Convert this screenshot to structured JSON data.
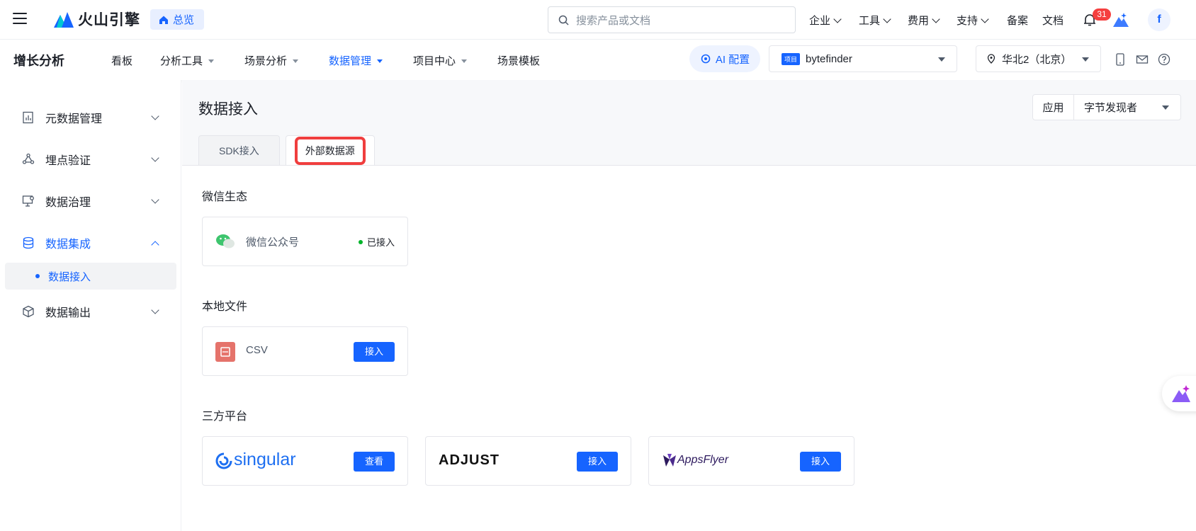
{
  "topbar": {
    "brand": "火山引擎",
    "overview_label": "总览",
    "search_placeholder": "搜索产品或文档",
    "nav": [
      "企业",
      "工具",
      "费用",
      "支持",
      "备案",
      "文档"
    ],
    "notification_count": "31",
    "avatar_initial": "f"
  },
  "subbar": {
    "product": "增长分析",
    "nav": [
      "看板",
      "分析工具",
      "场景分析",
      "数据管理",
      "项目中心",
      "场景模板"
    ],
    "ai_config": "AI 配置",
    "project_tag": "项目",
    "project_name": "bytefinder",
    "region": "华北2（北京）"
  },
  "sidebar": {
    "items": [
      "元数据管理",
      "埋点验证",
      "数据治理",
      "数据集成",
      "数据输出"
    ],
    "sub_item": "数据接入"
  },
  "main": {
    "title": "数据接入",
    "app_label": "应用",
    "app_value": "字节发现者",
    "tabs": [
      "SDK接入",
      "外部数据源"
    ],
    "sections": {
      "wechat": {
        "title": "微信生态",
        "card_name": "微信公众号",
        "status": "已接入"
      },
      "local": {
        "title": "本地文件",
        "card_name": "CSV",
        "button": "接入"
      },
      "third": {
        "title": "三方平台",
        "cards": [
          {
            "logo": "singular",
            "button": "查看"
          },
          {
            "logo": "ADJUST",
            "button": "接入"
          },
          {
            "logo": "AppsFlyer",
            "button": "接入"
          }
        ]
      }
    }
  },
  "colors": {
    "accent": "#1664ff",
    "highlight": "#f03e3e",
    "status_green": "#00b42a"
  }
}
